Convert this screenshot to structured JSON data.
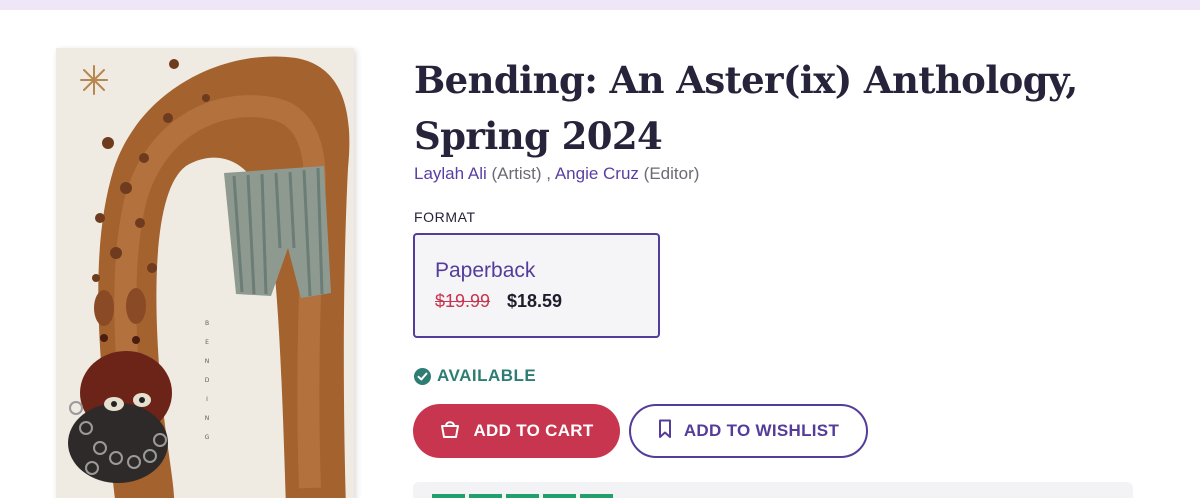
{
  "header": {
    "accent_color": "#efe6f8"
  },
  "book": {
    "title": "Bending: An Aster(ix) Anthology, Spring 2024",
    "cover_spine_text": [
      "B",
      "E",
      "N",
      "D",
      "I",
      "N",
      "G"
    ],
    "contributors": [
      {
        "name": "Laylah Ali",
        "role": "(Artist)"
      },
      {
        "name": "Angie Cruz",
        "role": "(Editor)"
      }
    ],
    "separator": ","
  },
  "format": {
    "label": "FORMAT",
    "selected": {
      "name": "Paperback",
      "original_price": "$19.99",
      "sale_price": "$18.59"
    }
  },
  "availability": {
    "status": "AVAILABLE",
    "icon": "check-circle-icon",
    "color": "#2e7d73"
  },
  "actions": {
    "add_to_cart": {
      "label": "ADD TO CART",
      "icon": "shopping-bag-icon",
      "color": "#c8354f"
    },
    "add_to_wishlist": {
      "label": "ADD TO WISHLIST",
      "icon": "bookmark-icon",
      "color": "#553c9a"
    }
  },
  "rating": {
    "star_color": "#22a06b",
    "stars": 5
  }
}
